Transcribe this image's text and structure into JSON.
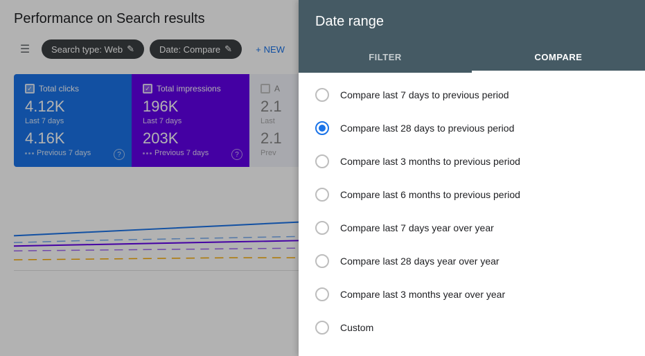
{
  "page": {
    "title": "Performance on Search results"
  },
  "toolbar": {
    "filter_icon": "≡",
    "chip1_label": "Search type: Web",
    "chip1_icon": "✎",
    "chip2_label": "Date: Compare",
    "chip2_icon": "✎",
    "new_icon": "+",
    "new_label": "NEW"
  },
  "metrics": [
    {
      "id": "total-clicks",
      "label": "Total clicks",
      "value": "4.12K",
      "period_label": "Last 7 days",
      "value2": "4.16K",
      "period_label2": "Previous 7 days",
      "color": "blue"
    },
    {
      "id": "total-impressions",
      "label": "Total impressions",
      "value": "196K",
      "period_label": "Last 7 days",
      "value2": "203K",
      "period_label2": "Previous 7 days",
      "color": "purple"
    },
    {
      "id": "metric3",
      "label": "A",
      "value": "2.1",
      "period_label": "Last",
      "value2": "2.1",
      "period_label2": "Prev",
      "color": "light"
    }
  ],
  "modal": {
    "title": "Date range",
    "tabs": [
      {
        "id": "filter",
        "label": "FILTER",
        "active": false
      },
      {
        "id": "compare",
        "label": "COMPARE",
        "active": true
      }
    ],
    "options": [
      {
        "id": "opt1",
        "label": "Compare last 7 days to previous period",
        "selected": false
      },
      {
        "id": "opt2",
        "label": "Compare last 28 days to previous period",
        "selected": true
      },
      {
        "id": "opt3",
        "label": "Compare last 3 months to previous period",
        "selected": false
      },
      {
        "id": "opt4",
        "label": "Compare last 6 months to previous period",
        "selected": false
      },
      {
        "id": "opt5",
        "label": "Compare last 7 days year over year",
        "selected": false
      },
      {
        "id": "opt6",
        "label": "Compare last 28 days year over year",
        "selected": false
      },
      {
        "id": "opt7",
        "label": "Compare last 3 months year over year",
        "selected": false
      },
      {
        "id": "opt8",
        "label": "Custom",
        "selected": false
      }
    ]
  }
}
